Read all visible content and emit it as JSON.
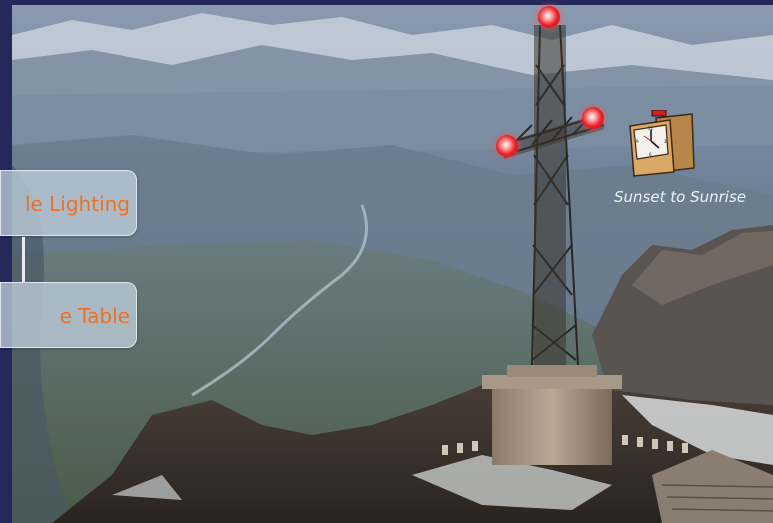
{
  "buttons": [
    {
      "label": "le Lighting"
    },
    {
      "label": "e Table"
    }
  ],
  "clock": {
    "caption": "Sunset to Sunrise",
    "icon": "clock-icon"
  },
  "beacons": [
    {
      "name": "top"
    },
    {
      "name": "right-arm"
    },
    {
      "name": "left-arm"
    }
  ],
  "colors": {
    "frame": "#25285a",
    "button_text": "#f07020",
    "beacon": "#e8202a"
  }
}
